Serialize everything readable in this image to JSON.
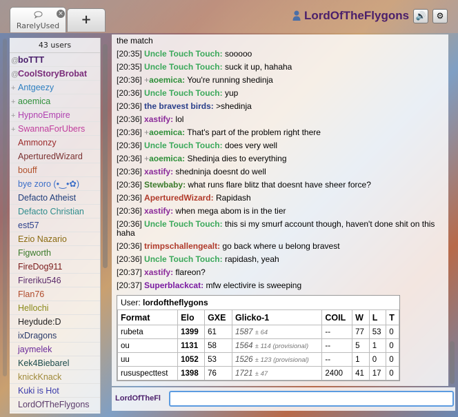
{
  "tabs": [
    {
      "label": "RarelyUsed",
      "icon": "chat-bubble-icon",
      "close": "×"
    },
    {
      "label": "+"
    }
  ],
  "header": {
    "username": "LordOfTheFlygons",
    "sound_icon": "🔊",
    "gear_icon": "⚙"
  },
  "userlist": {
    "count": "43 users",
    "users": [
      {
        "group": "@",
        "name": "boTTT",
        "color": "#4a1f6b",
        "bold": true
      },
      {
        "group": "@",
        "name": "CoolStoryBrobat",
        "color": "#7a2c7a",
        "bold": true
      },
      {
        "group": "+",
        "name": "Antgeezy",
        "color": "#2e7fc0"
      },
      {
        "group": "+",
        "name": "aoemica",
        "color": "#2f8f3a"
      },
      {
        "group": "+",
        "name": "HypnoEmpire",
        "color": "#b040b0"
      },
      {
        "group": "+",
        "name": "SwannaForUbers",
        "color": "#c03c9c"
      },
      {
        "group": "",
        "name": "Ammonzy",
        "color": "#9a2a2a"
      },
      {
        "group": "",
        "name": "AperturedWizard",
        "color": "#7a3030"
      },
      {
        "group": "",
        "name": "bouff",
        "color": "#b0502a"
      },
      {
        "group": "",
        "name": "bye zoro (•‿•✿)",
        "color": "#3c6fc8"
      },
      {
        "group": "",
        "name": "Defacto Atheist",
        "color": "#1e3c7a"
      },
      {
        "group": "",
        "name": "Defacto Christian",
        "color": "#2e8c8c"
      },
      {
        "group": "",
        "name": "est57",
        "color": "#2a3f8a"
      },
      {
        "group": "",
        "name": "Ezio Nazario",
        "color": "#8a6a10"
      },
      {
        "group": "",
        "name": "Figworth",
        "color": "#3a7a2a"
      },
      {
        "group": "",
        "name": "FireDog911",
        "color": "#7a1a1a"
      },
      {
        "group": "",
        "name": "Fireriku546",
        "color": "#5a2a6a"
      },
      {
        "group": "",
        "name": "Flan76",
        "color": "#b04a2a"
      },
      {
        "group": "",
        "name": "Hellochi",
        "color": "#8a8a1a"
      },
      {
        "group": "",
        "name": "Heydude:D",
        "color": "#222222"
      },
      {
        "group": "",
        "name": "ixDragons",
        "color": "#2a3a6a"
      },
      {
        "group": "",
        "name": "jaymelek",
        "color": "#6a2a9a"
      },
      {
        "group": "",
        "name": "Kek4Biebarel",
        "color": "#1a4a4a"
      },
      {
        "group": "",
        "name": "knickKnack",
        "color": "#a08a3a"
      },
      {
        "group": "",
        "name": "Kuki is Hot",
        "color": "#3a3aaa"
      },
      {
        "group": "",
        "name": "LordOfTheFlygons",
        "color": "#5a3a6a"
      }
    ]
  },
  "chat": {
    "messages": [
      {
        "time": "",
        "group": "",
        "name": "",
        "color": "#000000",
        "text": "the match"
      },
      {
        "time": "[20:35]",
        "group": "",
        "name": "Uncle Touch Touch:",
        "color": "#3aa85a",
        "text": "sooooo"
      },
      {
        "time": "[20:35]",
        "group": "",
        "name": "Uncle Touch Touch:",
        "color": "#3aa85a",
        "text": "suck it up, hahaha"
      },
      {
        "time": "[20:36]",
        "group": "+",
        "name": "aoemica:",
        "color": "#2f8f3a",
        "text": "You're running shedinja"
      },
      {
        "time": "[20:36]",
        "group": "",
        "name": "Uncle Touch Touch:",
        "color": "#3aa85a",
        "text": "yup"
      },
      {
        "time": "[20:36]",
        "group": "",
        "name": "the bravest birds:",
        "color": "#2a3f8a",
        "text": ">shedinja"
      },
      {
        "time": "[20:36]",
        "group": "",
        "name": "xastify:",
        "color": "#8a2a9a",
        "text": "lol"
      },
      {
        "time": "[20:36]",
        "group": "+",
        "name": "aoemica:",
        "color": "#2f8f3a",
        "text": "That's part of the problem right there"
      },
      {
        "time": "[20:36]",
        "group": "",
        "name": "Uncle Touch Touch:",
        "color": "#3aa85a",
        "text": "does very well"
      },
      {
        "time": "[20:36]",
        "group": "+",
        "name": "aoemica:",
        "color": "#2f8f3a",
        "text": "Shedinja dies to everything"
      },
      {
        "time": "[20:36]",
        "group": "",
        "name": "xastify:",
        "color": "#8a2a9a",
        "text": "shedninja doesnt do well"
      },
      {
        "time": "[20:36]",
        "group": "",
        "name": "Stewbaby:",
        "color": "#3a7a2a",
        "text": "what runs flare blitz that doesnt have sheer force?"
      },
      {
        "time": "[20:36]",
        "group": "",
        "name": "AperturedWizard:",
        "color": "#b03a2a",
        "text": "Rapidash"
      },
      {
        "time": "[20:36]",
        "group": "",
        "name": "xastify:",
        "color": "#8a2a9a",
        "text": "when mega abom is in the tier"
      },
      {
        "time": "[20:36]",
        "group": "",
        "name": "Uncle Touch Touch:",
        "color": "#3aa85a",
        "text": "this si my smurf account though, haven't done shit on this haha",
        "wrap": true
      },
      {
        "time": "[20:36]",
        "group": "",
        "name": "trimpschallengealt:",
        "color": "#b03a2a",
        "text": "go back where u belong bravest"
      },
      {
        "time": "[20:36]",
        "group": "",
        "name": "Uncle Touch Touch:",
        "color": "#3aa85a",
        "text": "rapidash, yeah"
      },
      {
        "time": "[20:37]",
        "group": "",
        "name": "xastify:",
        "color": "#8a2a9a",
        "text": "flareon?"
      },
      {
        "time": "[20:37]",
        "group": "",
        "name": "Superblackcat:",
        "color": "#7a1aa0",
        "text": "mfw electivire is sweeping"
      }
    ],
    "rating": {
      "user_label": "User:",
      "user": "lordoftheflygons",
      "headers": [
        "Format",
        "Elo",
        "GXE",
        "Glicko-1",
        "COIL",
        "W",
        "L",
        "T"
      ],
      "rows": [
        {
          "format": "rubeta",
          "elo": "1399",
          "gxe": "61",
          "glicko": "1587",
          "dev": "± 64",
          "coil": "--",
          "w": "77",
          "l": "53",
          "t": "0"
        },
        {
          "format": "ou",
          "elo": "1131",
          "gxe": "58",
          "glicko": "1564",
          "dev": "± 114 (provisional)",
          "coil": "--",
          "w": "5",
          "l": "1",
          "t": "0"
        },
        {
          "format": "uu",
          "elo": "1052",
          "gxe": "53",
          "glicko": "1526",
          "dev": "± 123 (provisional)",
          "coil": "--",
          "w": "1",
          "l": "0",
          "t": "0"
        },
        {
          "format": "rususpecttest",
          "elo": "1398",
          "gxe": "76",
          "glicko": "1721",
          "dev": "± 47",
          "coil": "2400",
          "w": "41",
          "l": "17",
          "t": "0"
        }
      ]
    },
    "input_name": "LordOfTheFl",
    "input_value": ""
  }
}
